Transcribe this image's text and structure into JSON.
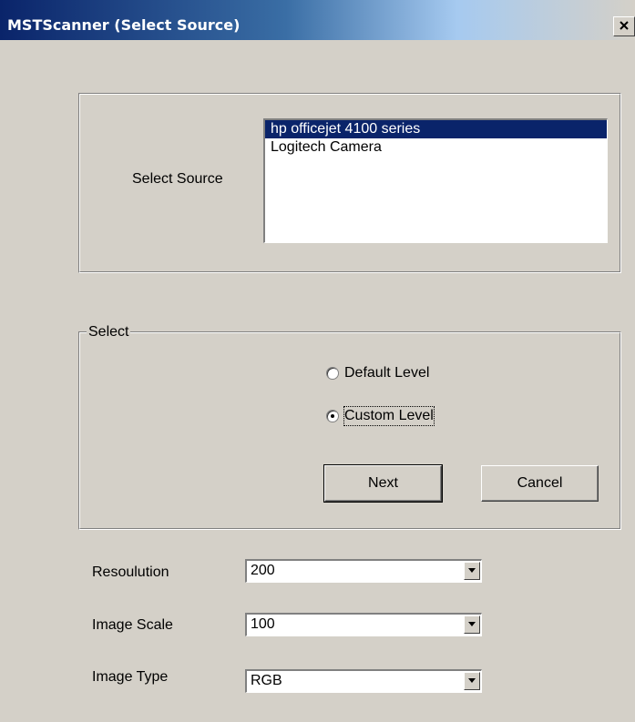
{
  "window": {
    "title": "MSTScanner (Select Source)",
    "close_icon": "close-icon"
  },
  "source_panel": {
    "label": "Select Source",
    "items": [
      {
        "label": "hp officejet 4100 series",
        "selected": true
      },
      {
        "label": "Logitech Camera",
        "selected": false
      }
    ]
  },
  "select_group": {
    "legend": "Select",
    "options": [
      {
        "label": "Default Level",
        "checked": false
      },
      {
        "label": "Custom Level",
        "checked": true
      }
    ],
    "next_label": "Next",
    "cancel_label": "Cancel"
  },
  "settings": {
    "resolution_label": "Resoulution",
    "resolution_value": "200",
    "scale_label": "Image Scale",
    "scale_value": "100",
    "type_label": "Image Type",
    "type_value": "RGB"
  },
  "colors": {
    "selection": "#0a246a",
    "face": "#d4d0c8"
  }
}
